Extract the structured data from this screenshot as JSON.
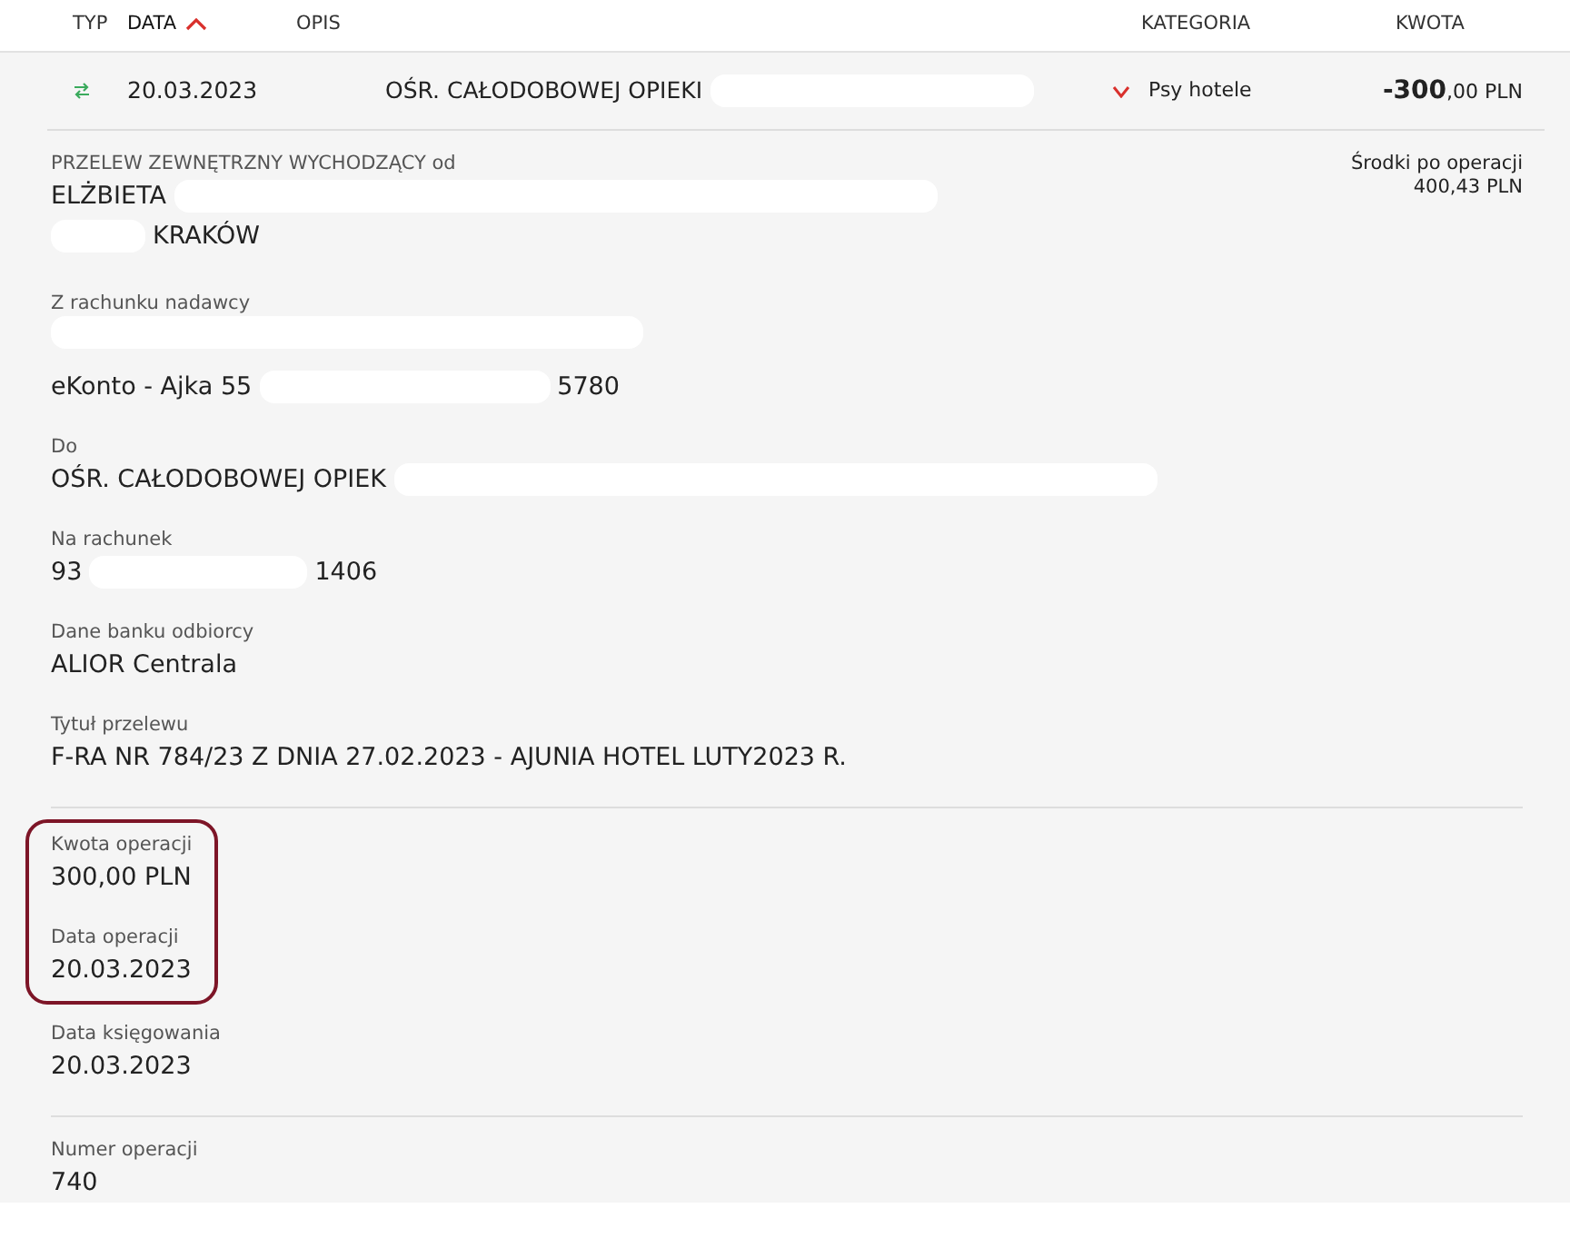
{
  "table": {
    "columns": [
      {
        "label": "TYP",
        "sorted": false
      },
      {
        "label": "DATA",
        "sorted": true
      },
      {
        "label": "OPIS",
        "sorted": false
      },
      {
        "label": "KATEGORIA",
        "sorted": false
      },
      {
        "label": "KWOTA",
        "sorted": false
      }
    ],
    "row": {
      "date": "20.03.2023",
      "description": "OŚR. CAŁODOBOWEJ OPIEKI",
      "description_redacted": true,
      "expanded": true,
      "category": "Psy hotele",
      "amount_main": "-300",
      "amount_fraction": ",00 PLN"
    }
  },
  "details": {
    "balance_label": "Środki po operacji",
    "balance_value": "400,43 PLN",
    "groups": [
      {
        "fields": [
          {
            "kind": "field",
            "label": "PRZELEW ZEWNĘTRZNY WYCHODZĄCY od",
            "lines": [
              [
                {
                  "kind": "text",
                  "text": "ELŻBIETA"
                },
                {
                  "kind": "redaction"
                }
              ],
              [
                {
                  "kind": "redaction"
                },
                {
                  "kind": "text",
                  "text": "KRAKÓW"
                }
              ]
            ]
          },
          {
            "kind": "field",
            "label": "Z rachunku nadawcy",
            "lines": [
              [
                {
                  "kind": "redaction"
                }
              ],
              [
                {
                  "kind": "text",
                  "text": "eKonto - Ajka 55"
                },
                {
                  "kind": "redaction"
                },
                {
                  "kind": "text",
                  "text": "5780"
                }
              ]
            ]
          },
          {
            "kind": "field",
            "label": "Do",
            "lines": [
              [
                {
                  "kind": "text",
                  "text": "OŚR. CAŁODOBOWEJ OPIEK"
                },
                {
                  "kind": "redaction"
                }
              ]
            ]
          },
          {
            "kind": "field",
            "label": "Na rachunek",
            "lines": [
              [
                {
                  "kind": "text",
                  "text": "93"
                },
                {
                  "kind": "redaction"
                },
                {
                  "kind": "text",
                  "text": "1406"
                }
              ]
            ]
          },
          {
            "kind": "field",
            "label": "Dane banku odbiorcy",
            "lines": [
              [
                {
                  "kind": "text",
                  "text": "ALIOR Centrala"
                }
              ]
            ]
          },
          {
            "kind": "field",
            "label": "Tytuł przelewu",
            "lines": [
              [
                {
                  "kind": "text",
                  "text": "F-RA NR 784/23 Z DNIA 27.02.2023 - AJUNIA HOTEL LUTY2023 R."
                }
              ]
            ]
          }
        ]
      },
      {
        "fields": [
          {
            "kind": "framed",
            "fields": [
              {
                "kind": "field",
                "label": "Kwota operacji",
                "lines": [
                  [
                    {
                      "kind": "text",
                      "text": "300,00 PLN"
                    }
                  ]
                ]
              },
              {
                "kind": "field",
                "label": "Data operacji",
                "lines": [
                  [
                    {
                      "kind": "text",
                      "text": "20.03.2023"
                    }
                  ]
                ]
              }
            ]
          },
          {
            "kind": "field",
            "label": "Data księgowania",
            "lines": [
              [
                {
                  "kind": "text",
                  "text": "20.03.2023"
                }
              ]
            ]
          }
        ]
      },
      {
        "fields": [
          {
            "kind": "field",
            "label": "Numer operacji",
            "lines": [
              [
                {
                  "kind": "text",
                  "text": "740"
                }
              ]
            ]
          }
        ]
      }
    ]
  }
}
